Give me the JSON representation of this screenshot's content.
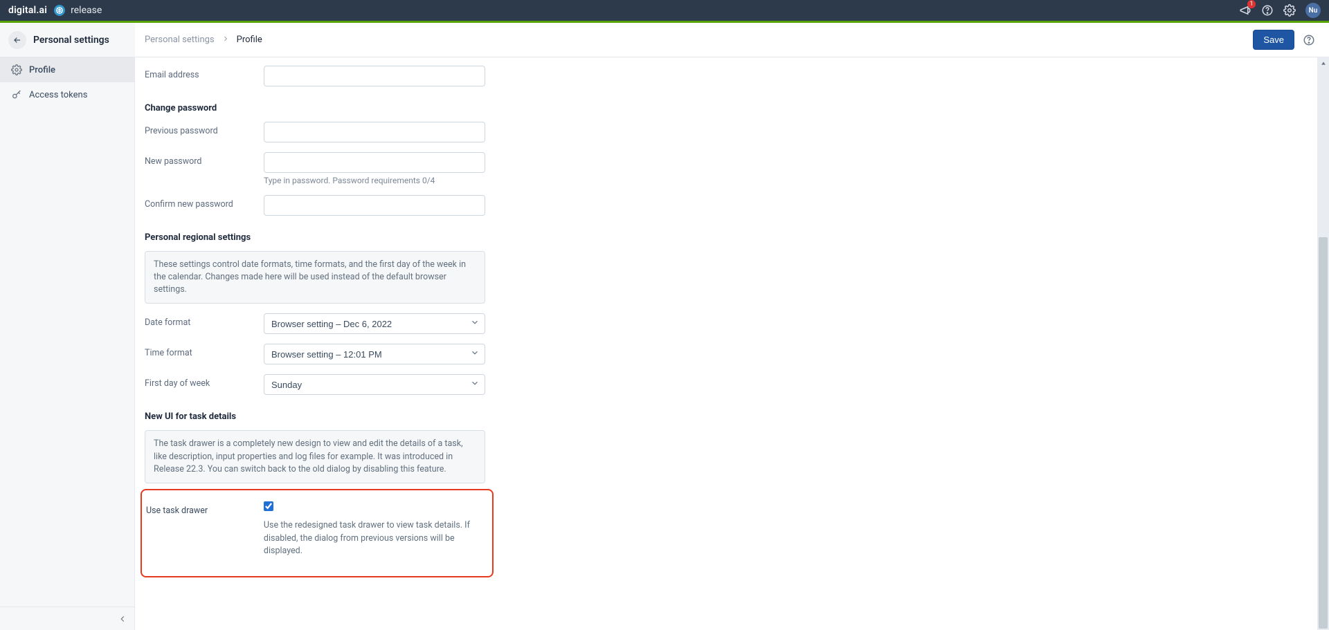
{
  "topbar": {
    "brand_primary": "digital.ai",
    "brand_secondary": "release",
    "notification_count": "1",
    "avatar_initials": "Nu"
  },
  "subheader": {
    "left_title": "Personal settings",
    "breadcrumb_root": "Personal settings",
    "breadcrumb_current": "Profile",
    "save_label": "Save"
  },
  "sidebar": {
    "items": [
      {
        "label": "Profile",
        "active": true
      },
      {
        "label": "Access tokens",
        "active": false
      }
    ]
  },
  "form": {
    "email_label": "Email address",
    "email_value": "",
    "change_password_title": "Change password",
    "previous_password_label": "Previous password",
    "new_password_label": "New password",
    "new_password_hint": "Type in password.  Password requirements 0/4",
    "confirm_password_label": "Confirm new password",
    "regional_title": "Personal regional settings",
    "regional_info": "These settings control date formats, time formats, and the first day of the week in the calendar. Changes made here will be used instead of the default browser settings.",
    "date_format_label": "Date format",
    "date_format_value": "Browser setting – Dec 6, 2022",
    "time_format_label": "Time format",
    "time_format_value": "Browser setting – 12:01 PM",
    "first_day_label": "First day of week",
    "first_day_value": "Sunday",
    "new_ui_title": "New UI for task details",
    "new_ui_info": "The task drawer is a completely new design to view and edit the details of a task, like description, input properties and log files for example. It was introduced in Release 22.3. You can switch back to the old dialog by disabling this feature.",
    "use_task_drawer_label": "Use task drawer",
    "use_task_drawer_desc": "Use the redesigned task drawer to view task details. If disabled, the dialog from previous versions will be displayed."
  }
}
